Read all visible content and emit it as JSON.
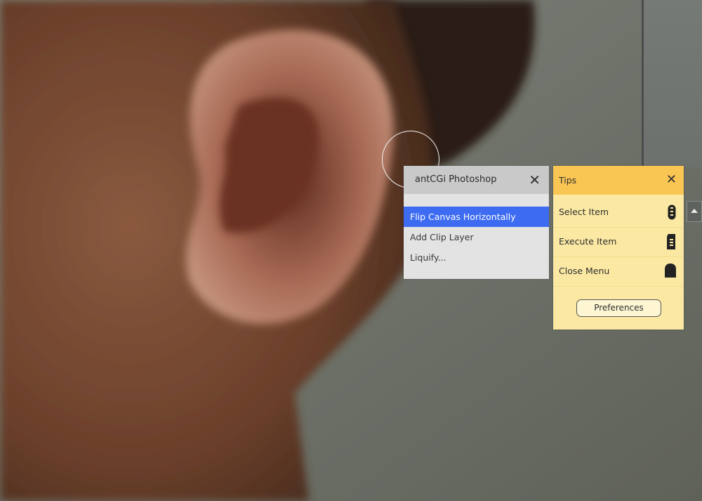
{
  "popup": {
    "title": "antCGi Photoshop",
    "close_glyph": "✕",
    "items": [
      {
        "label": "Flip Canvas Horizontally",
        "active": true
      },
      {
        "label": "Add Clip Layer",
        "active": false
      },
      {
        "label": "Liquify...",
        "active": false
      }
    ]
  },
  "tips": {
    "title": "Tips",
    "close_glyph": "✕",
    "rows": [
      {
        "label": "Select Item",
        "icon": "scroll-wheel-icon"
      },
      {
        "label": "Execute Item",
        "icon": "mouse-button-icon"
      },
      {
        "label": "Close Menu",
        "icon": "mouse-icon"
      }
    ],
    "preferences_label": "Preferences"
  },
  "colors": {
    "popup_bg": "#e3e3e3",
    "popup_header": "#c9c9c9",
    "active_item": "#3d6cf2",
    "tips_bg": "#fbe9a3",
    "tips_header": "#f9c553"
  }
}
